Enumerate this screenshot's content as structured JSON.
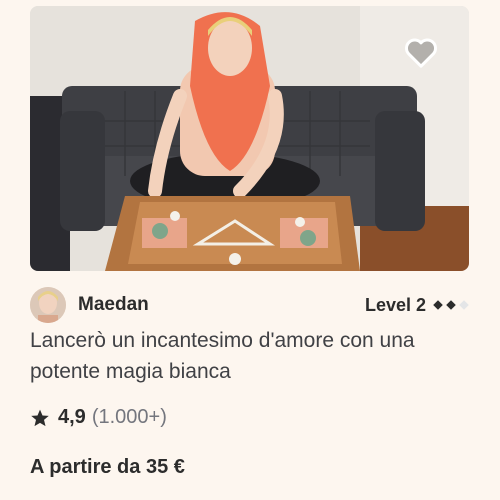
{
  "gig": {
    "image_alt_subject": "tarot-reading-photo",
    "favorite_icon": "heart-icon",
    "seller": {
      "name": "Maedan",
      "level_label": "Level 2",
      "level_icon": "diamond-icon",
      "level_filled": 2,
      "level_total": 3
    },
    "title": "Lancerò un incantesimo d'amore con una potente magia bianca",
    "rating": {
      "icon": "star-icon",
      "score": "4,9",
      "count": "(1.000+)"
    },
    "price_label": "A partire da 35 €"
  },
  "colors": {
    "background": "#fdf6ef",
    "text_primary": "#2c2c2c",
    "text_secondary": "#74767e",
    "scarf": "#f0714f"
  }
}
